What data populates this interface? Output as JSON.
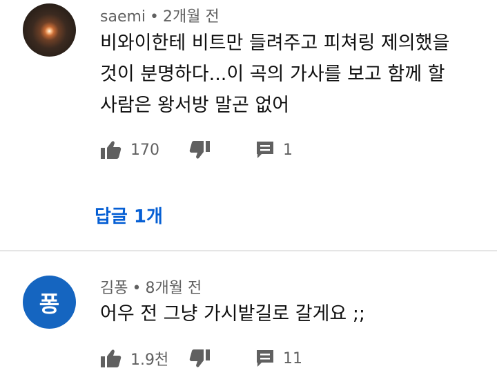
{
  "comments": [
    {
      "author": "saemi",
      "time": "2개월 전",
      "avatar_letter": "",
      "text": "비와이한테 비트만 들려주고 피쳐링 제의했을 것이 분명하다...이 곡의 가사를 보고 함께 할 사람은 왕서방 말곤 없어",
      "likes": "170",
      "reply_count": "1",
      "replies_link": "답글 1개"
    },
    {
      "author": "김퐁",
      "time": "8개월 전",
      "avatar_letter": "퐁",
      "text": "어우 전 그냥 가시밭길로 갈게요 ;;",
      "likes": "1.9천",
      "reply_count": "11"
    }
  ],
  "meta_separator": "•",
  "icons": [
    "thumbs-up-icon",
    "thumbs-down-icon",
    "comment-icon",
    "more-vert-icon"
  ],
  "colors": {
    "link": "#065fd4",
    "meta": "#606060",
    "avatar_bg": "#1565c0"
  }
}
